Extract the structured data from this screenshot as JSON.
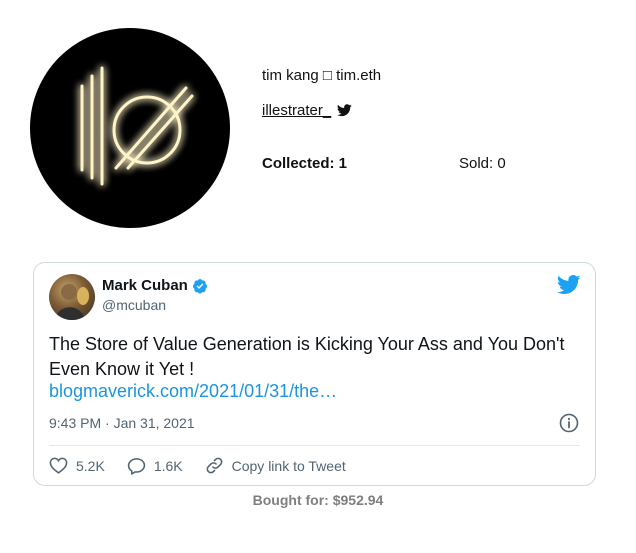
{
  "profile": {
    "display_name": "tim kang □ tim.eth",
    "twitter_handle": "illestrater_",
    "collected_label": "Collected: 1",
    "sold_label": "Sold: 0"
  },
  "tweet": {
    "author_name": "Mark Cuban",
    "author_handle": "@mcuban",
    "text": "The Store of Value Generation is Kicking Your Ass and You Don't Even Know it Yet !",
    "link": "blogmaverick.com/2021/01/31/the…",
    "timestamp": "9:43 PM · Jan 31, 2021",
    "likes": "5.2K",
    "replies": "1.6K",
    "copy_link_label": "Copy link to Tweet"
  },
  "purchase": {
    "bought_label": "Bought for: $952.94"
  },
  "icons": {
    "verified": "verified-badge-icon",
    "twitter": "twitter-bird-icon",
    "info": "info-icon",
    "like": "heart-icon",
    "reply": "reply-icon",
    "copy": "link-icon"
  },
  "colors": {
    "twitter_blue": "#1da1f2",
    "link_blue": "#1b95e0",
    "muted_text": "#536471",
    "bought_gray": "#7f7f7f",
    "logo_glow": "#ffe9a8"
  }
}
